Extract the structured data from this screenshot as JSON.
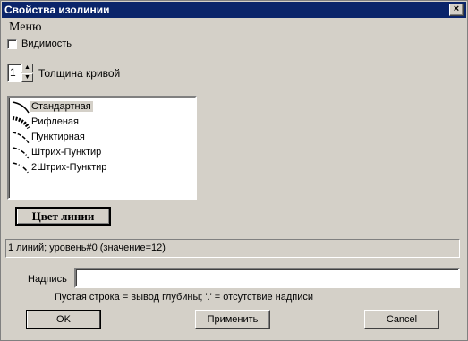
{
  "window": {
    "title": "Свойства изолинии",
    "close_glyph": "×"
  },
  "menu_label": "Меню",
  "visibility": {
    "label": "Видимость",
    "checked": false
  },
  "thickness": {
    "value": "1",
    "label": "Толщина кривой",
    "up_glyph": "▲",
    "down_glyph": "▼"
  },
  "line_styles": {
    "items": [
      {
        "label": "Стандартная",
        "icon": "solid-line-icon",
        "selected": true
      },
      {
        "label": "Рифленая",
        "icon": "corrugated-line-icon",
        "selected": false
      },
      {
        "label": "Пунктирная",
        "icon": "dashed-line-icon",
        "selected": false
      },
      {
        "label": "Штрих-Пунктир",
        "icon": "dash-dot-line-icon",
        "selected": false
      },
      {
        "label": "2Штрих-Пунктир",
        "icon": "dash-dot-dot-line-icon",
        "selected": false
      }
    ]
  },
  "color_button": {
    "label": "Цвет линии"
  },
  "status": {
    "text": "1 линий; уровень#0 (значение=12)"
  },
  "caption": {
    "label": "Надпись",
    "value": "",
    "hint": "Пустая строка = вывод глубины; '.' = отсутствие надписи"
  },
  "buttons": {
    "ok": "OK",
    "apply": "Применить",
    "cancel": "Cancel"
  },
  "colors": {
    "titlebar": "#0a246a",
    "face": "#d4d0c8",
    "selection": "#d4d0c8"
  }
}
